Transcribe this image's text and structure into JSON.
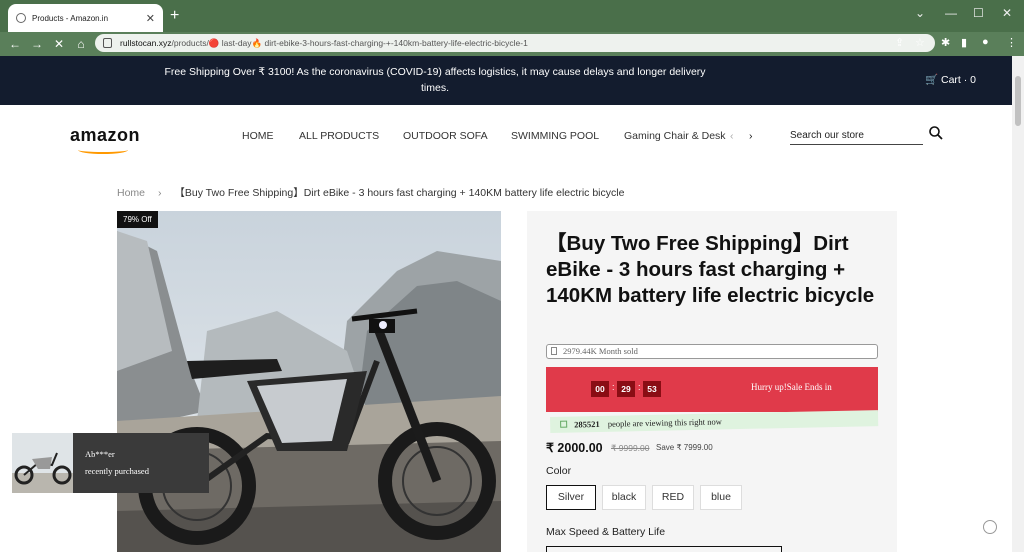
{
  "browser": {
    "tab_title": "Products - Amazon.in",
    "tab_close": "✕",
    "new_tab": "+",
    "url_host": "rullstocan.xyz",
    "url_path": "/products/🔴 last-day🔥 dirt-ebike-3-hours-fast-charging-+-140km-battery-life-electric-bicycle-1"
  },
  "announcement": {
    "text": "Free Shipping Over ₹ 3100! As the coronavirus (COVID-19) affects logistics, it may cause delays and longer delivery times.",
    "cart_label": "Cart · 0"
  },
  "header": {
    "logo": "amazon",
    "menu": [
      "HOME",
      "ALL PRODUCTS",
      "OUTDOOR SOFA",
      "SWIMMING POOL",
      "Gaming Chair & Desk"
    ],
    "search_placeholder": "Search our store"
  },
  "breadcrumb": {
    "home": "Home",
    "current": "【Buy Two Free Shipping】Dirt eBike - 3 hours fast charging + 140KM battery life electric bicycle"
  },
  "product": {
    "badge": "79%  Off",
    "title": "【Buy Two Free Shipping】Dirt eBike - 3 hours fast charging + 140KM battery life electric bicycle",
    "sold": "2979.44K  Month sold",
    "countdown": {
      "hh": "00",
      "mm": "29",
      "ss": "53"
    },
    "hurry_text": "Hurry up!Sale Ends in",
    "viewers": "285521",
    "viewing_text": "people are viewing this right now",
    "price": "₹ 2000.00",
    "compare_price": "₹ 9999.00",
    "save_text": "Save ₹ 7999.00",
    "color_label": "Color",
    "colors": [
      "Silver",
      "black",
      "RED",
      "blue"
    ],
    "selected_color": "Silver",
    "max_speed_label": "Max Speed & Battery Life"
  },
  "popup": {
    "name": "Ab***er",
    "action": "recently purchased"
  },
  "colors": {
    "chrome": "#4a6f4a",
    "announcement_bg": "#131c2e",
    "countdown_bg": "#e03a4a",
    "countdown_box": "#8a0d14",
    "viewing_bg": "#dff3df",
    "amazon_orange": "#ff9900"
  }
}
